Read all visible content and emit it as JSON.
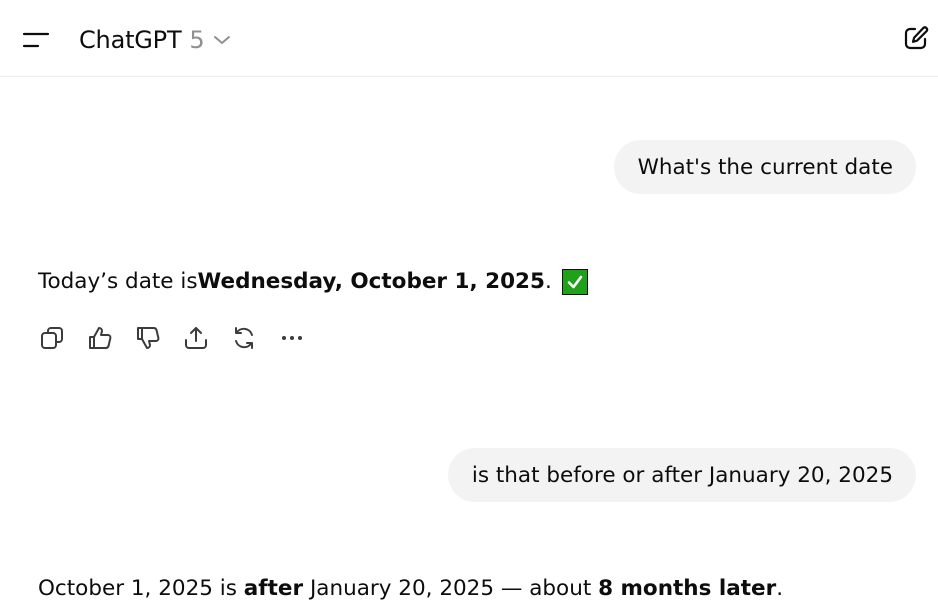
{
  "header": {
    "model_name": "ChatGPT",
    "model_version": "5"
  },
  "messages": [
    {
      "role": "user",
      "text": "What's the current date"
    },
    {
      "role": "assistant",
      "parts": [
        "Today’s date is ",
        "Wednesday, October 1, 2025",
        "."
      ],
      "emoji": "check-mark-button"
    },
    {
      "role": "user",
      "text": "is that before or after January 20, 2025"
    },
    {
      "role": "assistant",
      "parts": [
        "October 1, 2025 is ",
        "after",
        " January 20, 2025 — about ",
        "8 months later",
        "."
      ]
    }
  ],
  "actions": [
    "copy-icon",
    "thumbs-up-icon",
    "thumbs-down-icon",
    "share-icon",
    "regenerate-icon",
    "more-icon"
  ],
  "colors": {
    "bubble_bg": "#f3f3f3",
    "version_gray": "#8f8f8f",
    "check_green": "#1fa11a"
  }
}
